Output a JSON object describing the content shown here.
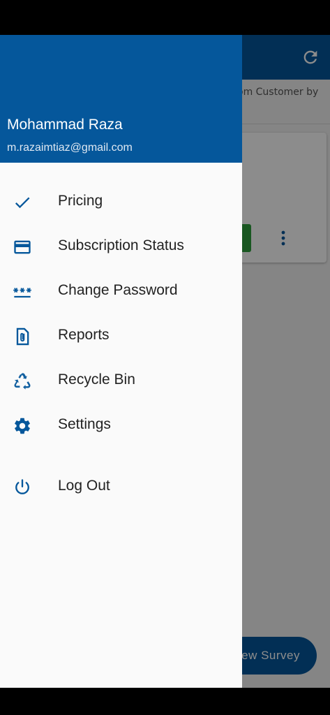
{
  "background_screen": {
    "subtitle": "om Customer by",
    "fab_label": "ew Survey"
  },
  "drawer": {
    "user_name": "Mohammad Raza",
    "user_email": "m.razaimtiaz@gmail.com",
    "items": [
      {
        "label": "Pricing",
        "icon": "check-icon"
      },
      {
        "label": "Subscription Status",
        "icon": "credit-card-icon"
      },
      {
        "label": "Change Password",
        "icon": "password-icon"
      },
      {
        "label": "Reports",
        "icon": "document-attachment-icon"
      },
      {
        "label": "Recycle Bin",
        "icon": "recycle-icon"
      },
      {
        "label": "Settings",
        "icon": "gear-icon"
      },
      {
        "label": "Log Out",
        "icon": "power-icon"
      }
    ]
  },
  "colors": {
    "primary": "#05579b",
    "drawer_background": "#fafafa",
    "text": "#222222"
  }
}
